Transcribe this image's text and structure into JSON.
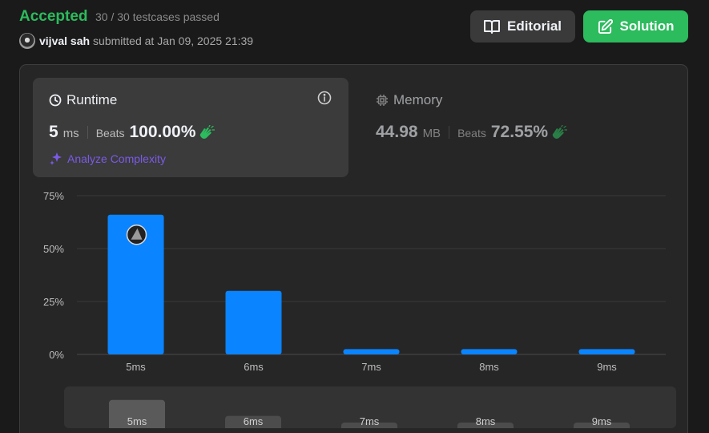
{
  "header": {
    "status": "Accepted",
    "testcases": "30 / 30 testcases passed",
    "username": "vijval sah",
    "submitted": "submitted at Jan 09, 2025 21:39",
    "editorial_label": "Editorial",
    "solution_label": "Solution"
  },
  "runtime": {
    "title": "Runtime",
    "value": "5",
    "unit": "ms",
    "beats_label": "Beats",
    "beats": "100.00%",
    "analyze": "Analyze Complexity"
  },
  "memory": {
    "title": "Memory",
    "value": "44.98",
    "unit": "MB",
    "beats_label": "Beats",
    "beats": "72.55%"
  },
  "colors": {
    "accepted": "#2cbb5d",
    "bar": "#0a84ff",
    "analyze": "#7b5ae8"
  },
  "chart_data": {
    "type": "bar",
    "categories": [
      "5ms",
      "6ms",
      "7ms",
      "8ms",
      "9ms"
    ],
    "values": [
      66,
      30,
      2.5,
      2.5,
      2.5
    ],
    "yticks": [
      "0%",
      "25%",
      "50%",
      "75%"
    ],
    "ylim": [
      0,
      75
    ],
    "grid": true,
    "highlight_index": 0
  },
  "mini_chart": {
    "categories": [
      "5ms",
      "6ms",
      "7ms",
      "8ms",
      "9ms"
    ],
    "levels": [
      0.8,
      0.35,
      0.12,
      0.12,
      0.12
    ]
  }
}
